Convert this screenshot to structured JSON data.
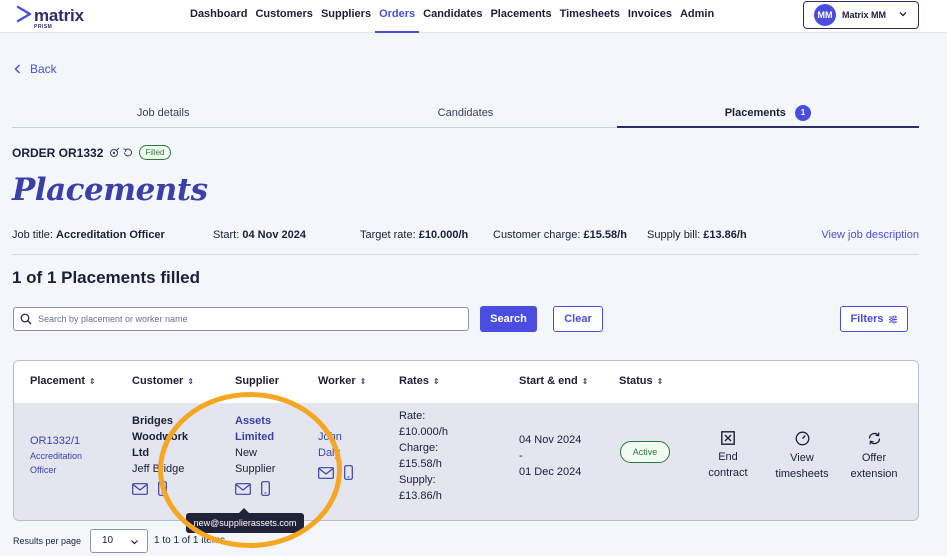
{
  "app": {
    "logo_text": "matrix",
    "logo_sub": "PRISM"
  },
  "nav": {
    "items": [
      "Dashboard",
      "Customers",
      "Suppliers",
      "Orders",
      "Candidates",
      "Placements",
      "Timesheets",
      "Invoices",
      "Admin"
    ],
    "active": "Orders"
  },
  "user": {
    "initials": "MM",
    "name": "Matrix MM"
  },
  "back_label": "Back",
  "tabs": [
    {
      "label": "Job details"
    },
    {
      "label": "Candidates"
    },
    {
      "label": "Placements",
      "badge": "1"
    }
  ],
  "order": {
    "title": "ORDER OR1332",
    "status_badge": "Filled"
  },
  "page_title": "Placements",
  "summary": {
    "job_title_label": "Job title:",
    "job_title": "Accreditation Officer",
    "start_label": "Start:",
    "start": "04 Nov 2024",
    "target_rate_label": "Target rate:",
    "target_rate": "£10.000/h",
    "customer_charge_label": "Customer charge:",
    "customer_charge": "£15.58/h",
    "supply_bill_label": "Supply bill:",
    "supply_bill": "£13.86/h",
    "view_link": "View job description"
  },
  "filled_heading": "1 of 1 Placements filled",
  "search": {
    "placeholder": "Search by placement or worker name",
    "value": "",
    "search_label": "Search",
    "clear_label": "Clear",
    "filters_label": "Filters"
  },
  "table": {
    "columns": [
      {
        "label": "Placement",
        "sortable": true
      },
      {
        "label": "Customer",
        "sortable": true
      },
      {
        "label": "Supplier",
        "sortable": false
      },
      {
        "label": "Worker",
        "sortable": true
      },
      {
        "label": "Rates",
        "sortable": true
      },
      {
        "label": "Start & end",
        "sortable": true
      },
      {
        "label": "Status",
        "sortable": true
      }
    ],
    "row": {
      "placement_id": "OR1332/1",
      "placement_role_1": "Accreditation",
      "placement_role_2": "Officer",
      "customer_1": "Bridges",
      "customer_2": "Woodwork",
      "customer_3": "Ltd",
      "customer_contact": "Jeff Bridge",
      "supplier_1": "Assets",
      "supplier_2": "Limited",
      "supplier_contact_1": "New",
      "supplier_contact_2": "Supplier",
      "worker_1": "John",
      "worker_2": "Daly",
      "rate_label": "Rate:",
      "rate": "£10.000/h",
      "charge_label": "Charge:",
      "charge": "£15.58/h",
      "supply_label": "Supply:",
      "supply": "£13.86/h",
      "start": "04 Nov 2024",
      "dash": "-",
      "end": "01 Dec 2024",
      "status": "Active",
      "actions": [
        {
          "line1": "End",
          "line2": "contract",
          "icon": "close-box-icon"
        },
        {
          "line1": "View",
          "line2": "timesheets",
          "icon": "clock-icon"
        },
        {
          "line1": "Offer",
          "line2": "extension",
          "icon": "refresh-icon"
        }
      ]
    }
  },
  "tooltip": "new@supplierassets.com",
  "pagination": {
    "per_page_label": "Results per page",
    "per_page": "10",
    "range": "1 to 1 of 1 items"
  },
  "colors": {
    "accent": "#4a4de0",
    "navy": "#2b2f66",
    "success": "#2b7a3a",
    "highlight": "#f5a623"
  }
}
